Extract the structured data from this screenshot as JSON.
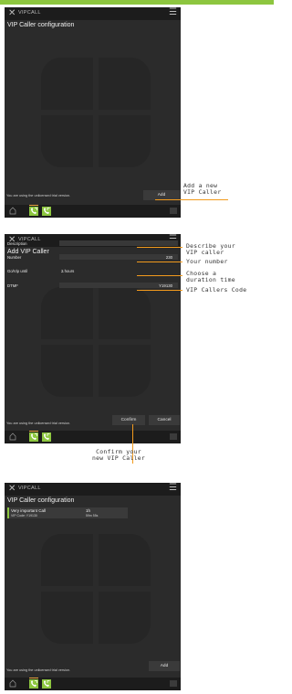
{
  "app": {
    "name": "VIPCALL"
  },
  "colors": {
    "accent": "#8dc63f",
    "annotation_line": "#f29a1d",
    "panel_bg": "#2b2b2b"
  },
  "screen1": {
    "title": "VIP Caller configuration",
    "trial_text": "You are using the unlicensed trial version.",
    "add_button": "Add"
  },
  "screen2": {
    "title": "Add VIP Caller",
    "fields": {
      "description": {
        "label": "Description",
        "value": ""
      },
      "number": {
        "label": "Number",
        "value": "230"
      },
      "go_vip_until": {
        "label": "Go/Vip until",
        "value": "2 hours"
      },
      "dtmf": {
        "label": "DTMF",
        "value": "Y19130"
      }
    },
    "trial_text": "You are using the unlicensed trial version.",
    "confirm_button": "Confirm",
    "cancel_button": "Cancel"
  },
  "screen3": {
    "title": "VIP Caller configuration",
    "entry": {
      "name": "Very important Call",
      "code": "VIP Code: Y19130",
      "duration": "1h",
      "remaining": "59m 55s"
    },
    "trial_text": "You are using the unlicensed trial version.",
    "add_button": "Add"
  },
  "annotations": {
    "add_new": [
      "Add a new",
      "VIP Caller"
    ],
    "describe": [
      "Describe your",
      "VIP caller"
    ],
    "number": [
      "Your number"
    ],
    "duration": [
      "Choose a",
      "duration time"
    ],
    "code": [
      "VIP Callers Code"
    ],
    "confirm": [
      "Confirm your",
      "new VIP Caller"
    ]
  },
  "icons": [
    "close-icon",
    "menu-icon",
    "home-icon",
    "phone-arrow-icon",
    "grid-icon"
  ]
}
